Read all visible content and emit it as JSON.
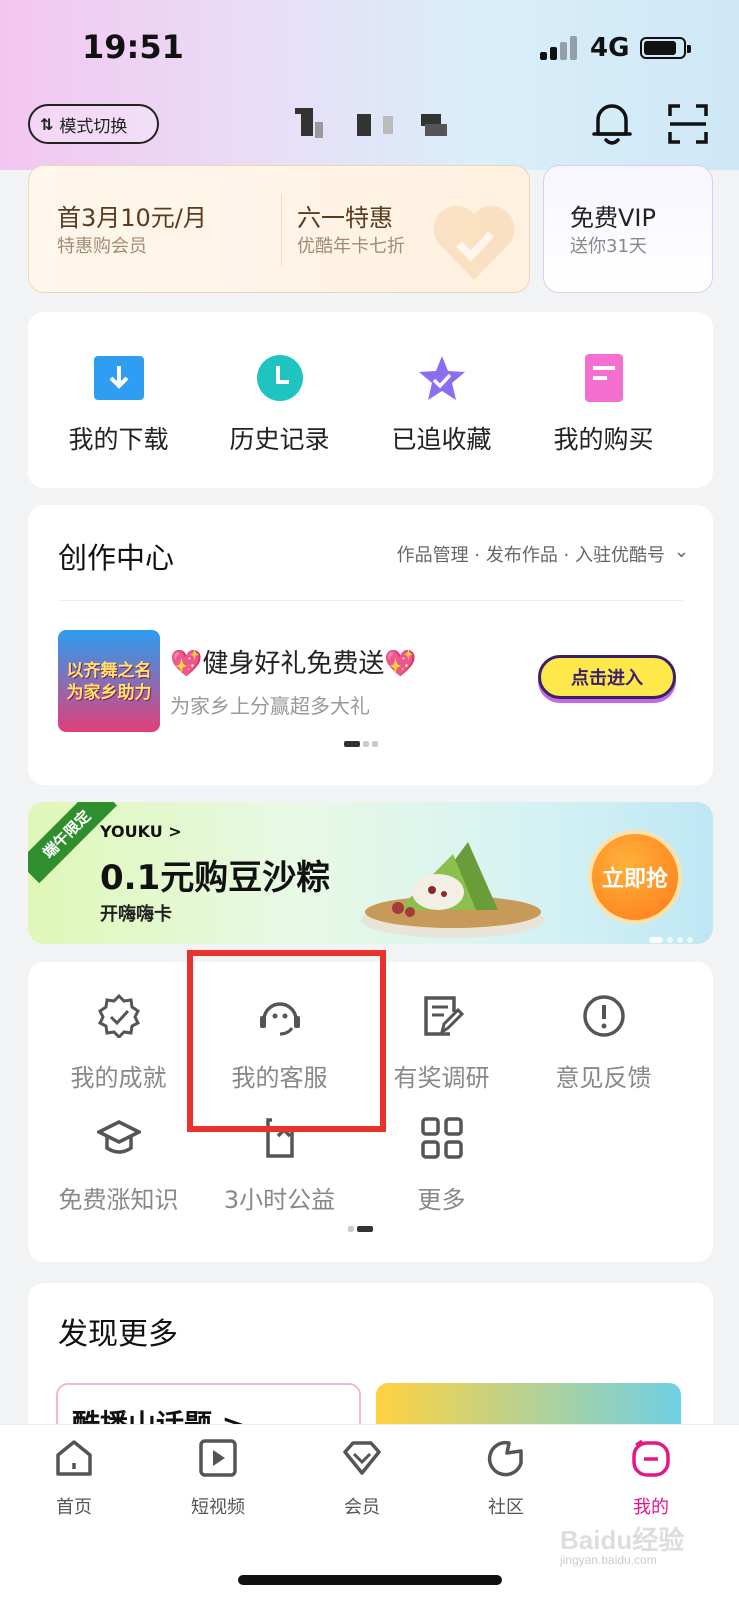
{
  "status": {
    "time": "19:51",
    "network": "4G"
  },
  "header": {
    "mode_switch_label": "模式切换"
  },
  "vip": {
    "offer1_title": "首3月10元/月",
    "offer1_sub": "特惠购会员",
    "offer2_title": "六一特惠",
    "offer2_sub": "优酷年卡七折",
    "offer3_title": "免费VIP",
    "offer3_sub": "送你31天"
  },
  "quick": [
    {
      "label": "我的下载",
      "icon": "download-icon",
      "color": "#2f9ef2"
    },
    {
      "label": "历史记录",
      "icon": "history-clock-icon",
      "color": "#1fc3c0"
    },
    {
      "label": "已追收藏",
      "icon": "star-icon",
      "color": "#8c6cf0"
    },
    {
      "label": "我的购买",
      "icon": "purchase-icon",
      "color": "#f46fcf"
    }
  ],
  "create": {
    "title": "创作中心",
    "links": "作品管理 · 发布作品 · 入驻优酷号",
    "promo_img_text": "以齐舞之名为家乡助力",
    "promo_title": "💖健身好礼免费送💖",
    "promo_sub": "为家乡上分赢超多大礼",
    "promo_button": "点击进入"
  },
  "banner": {
    "badge": "端午限定",
    "brand": "YOUKU >",
    "title": "0.1元购豆沙粽",
    "subtitle": "开嗨嗨卡",
    "button": "立即抢"
  },
  "tools": [
    {
      "label": "我的成就",
      "icon": "achievement-badge-icon"
    },
    {
      "label": "我的客服",
      "icon": "customer-service-icon"
    },
    {
      "label": "有奖调研",
      "icon": "survey-icon"
    },
    {
      "label": "意见反馈",
      "icon": "feedback-icon"
    },
    {
      "label": "免费涨知识",
      "icon": "graduation-cap-icon"
    },
    {
      "label": "3小时公益",
      "icon": "charity-icon"
    },
    {
      "label": "更多",
      "icon": "more-grid-icon"
    }
  ],
  "discover": {
    "title": "发现更多",
    "card1_title": "酷播山话题 >"
  },
  "tabs": [
    {
      "label": "首页",
      "icon": "home-icon"
    },
    {
      "label": "短视频",
      "icon": "short-video-icon"
    },
    {
      "label": "会员",
      "icon": "vip-diamond-icon"
    },
    {
      "label": "社区",
      "icon": "community-icon"
    },
    {
      "label": "我的",
      "icon": "profile-icon",
      "active": true
    }
  ],
  "colors": {
    "accent": "#e4168a",
    "highlight_box": "#e8322b"
  },
  "watermark": {
    "text": "Baidu经验",
    "sub": "jingyan.baidu.com"
  }
}
